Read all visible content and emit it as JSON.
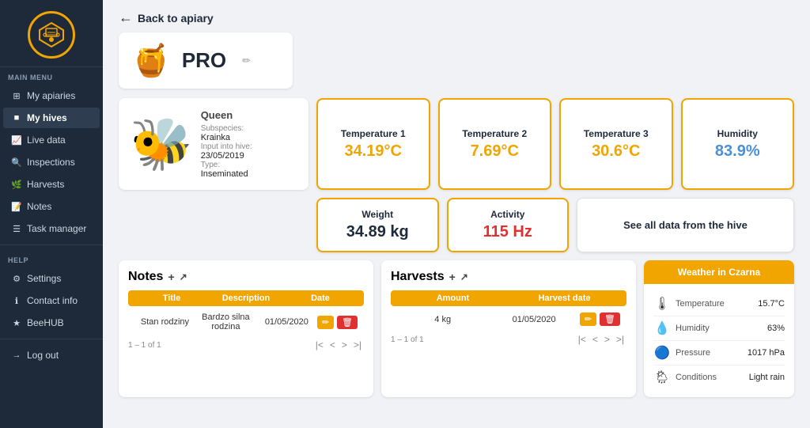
{
  "sidebar": {
    "menu_title": "MAIN MENU",
    "help_title": "HELP",
    "items": [
      {
        "label": "My apiaries",
        "icon": "⊞",
        "active": false,
        "name": "my-apiaries"
      },
      {
        "label": "My hives",
        "icon": "■",
        "active": true,
        "name": "my-hives"
      },
      {
        "label": "Live data",
        "icon": "📈",
        "active": false,
        "name": "live-data"
      },
      {
        "label": "Inspections",
        "icon": "🔍",
        "active": false,
        "name": "inspections"
      },
      {
        "label": "Harvests",
        "icon": "🌿",
        "active": false,
        "name": "harvests"
      },
      {
        "label": "Notes",
        "icon": "📝",
        "active": false,
        "name": "notes"
      },
      {
        "label": "Task manager",
        "icon": "☰",
        "active": false,
        "name": "task-manager"
      }
    ],
    "help_items": [
      {
        "label": "Settings",
        "icon": "⚙",
        "name": "settings"
      },
      {
        "label": "Contact info",
        "icon": "ℹ",
        "name": "contact-info"
      },
      {
        "label": "BeeHUB",
        "icon": "★",
        "name": "beehub"
      }
    ],
    "logout": "Log out"
  },
  "topbar": {
    "back_label": "Back to apiary",
    "back_icon": "←"
  },
  "hive": {
    "name": "PRO",
    "edit_icon": "✏"
  },
  "queen": {
    "title": "Queen",
    "subspecies_label": "Subspecies:",
    "subspecies_value": "Krainka",
    "input_label": "Input into hive:",
    "input_value": "23/05/2019",
    "type_label": "Type:",
    "type_value": "Inseminated"
  },
  "sensors": [
    {
      "label": "Temperature 1",
      "value": "34.19°C",
      "color": "orange"
    },
    {
      "label": "Temperature 2",
      "value": "7.69°C",
      "color": "orange"
    },
    {
      "label": "Temperature 3",
      "value": "30.6°C",
      "color": "orange"
    },
    {
      "label": "Humidity",
      "value": "83.9%",
      "color": "blue"
    }
  ],
  "weight": {
    "label": "Weight",
    "value": "34.89 kg",
    "color": "dark"
  },
  "activity": {
    "label": "Activity",
    "value": "115 Hz",
    "color": "red"
  },
  "all_data": {
    "label": "See all data from the hive"
  },
  "notes": {
    "title": "Notes",
    "add_icon": "+",
    "ext_icon": "↗",
    "columns": [
      "Title",
      "Description",
      "Date"
    ],
    "rows": [
      {
        "title": "Stan rodziny",
        "description": "Bardzo silna rodzina",
        "date": "01/05/2020"
      }
    ],
    "pagination": "1 – 1 of 1"
  },
  "harvests": {
    "title": "Harvests",
    "add_icon": "+",
    "ext_icon": "↗",
    "columns": [
      "Amount",
      "Harvest date"
    ],
    "rows": [
      {
        "amount": "4 kg",
        "date": "01/05/2020"
      }
    ],
    "pagination": "1 – 1 of 1"
  },
  "weather": {
    "title": "Weather in Czarna",
    "rows": [
      {
        "icon": "🌡",
        "label": "Temperature",
        "value": "15.7°C"
      },
      {
        "icon": "💧",
        "label": "Humidity",
        "value": "63%"
      },
      {
        "icon": "🔵",
        "label": "Pressure",
        "value": "1017 hPa"
      },
      {
        "icon": "🌦",
        "label": "Conditions",
        "value": "Light rain"
      }
    ]
  },
  "colors": {
    "accent": "#f0a500",
    "sidebar_bg": "#1e2a3a",
    "danger": "#e03030"
  }
}
